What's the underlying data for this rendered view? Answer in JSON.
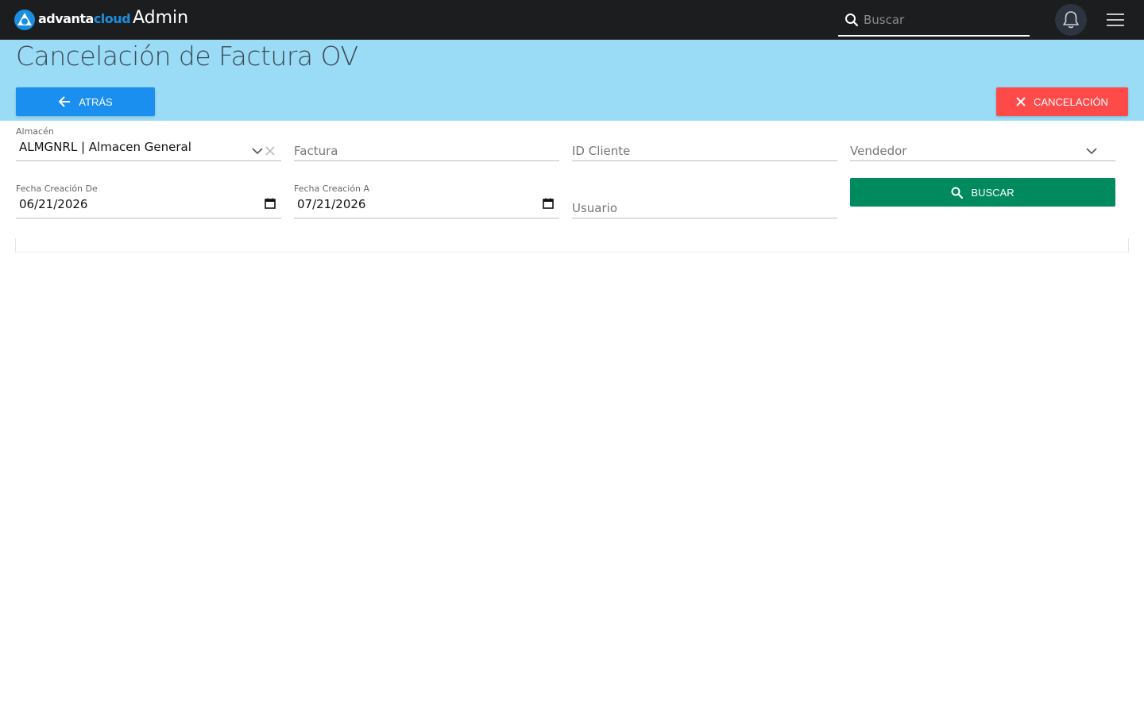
{
  "topbar": {
    "brand_part1": "advanta",
    "brand_part2": "cloud",
    "app_title": "Admin",
    "search_placeholder": "Buscar"
  },
  "header": {
    "page_title": "Cancelación de Factura OV",
    "back_label": "ATRÁS",
    "cancel_label": "CANCELACIÓN"
  },
  "form": {
    "almacen": {
      "label": "Almacén",
      "value": "ALMGNRL | Almacen General"
    },
    "factura": {
      "placeholder": "Factura"
    },
    "id_cliente": {
      "placeholder": "ID Cliente"
    },
    "vendedor": {
      "placeholder": "Vendedor"
    },
    "fecha_de": {
      "label": "Fecha Creación De",
      "value": "06/21/2026"
    },
    "fecha_a": {
      "label": "Fecha Creación A",
      "value": "07/21/2026"
    },
    "usuario": {
      "placeholder": "Usuario"
    },
    "search_label": "BUSCAR"
  },
  "colors": {
    "topbar_bg": "#1c1d1f",
    "band_bg": "#9adcf6",
    "back_btn": "#1a8ff0",
    "cancel_btn": "#ff4a4a",
    "search_btn": "#008a5e",
    "brand_accent": "#1a8fe0"
  },
  "icons": [
    "advanta-logo-icon",
    "search-icon",
    "bell-icon",
    "hamburger-menu-icon",
    "arrow-left-icon",
    "close-icon",
    "chevron-down-icon",
    "calendar-icon"
  ]
}
